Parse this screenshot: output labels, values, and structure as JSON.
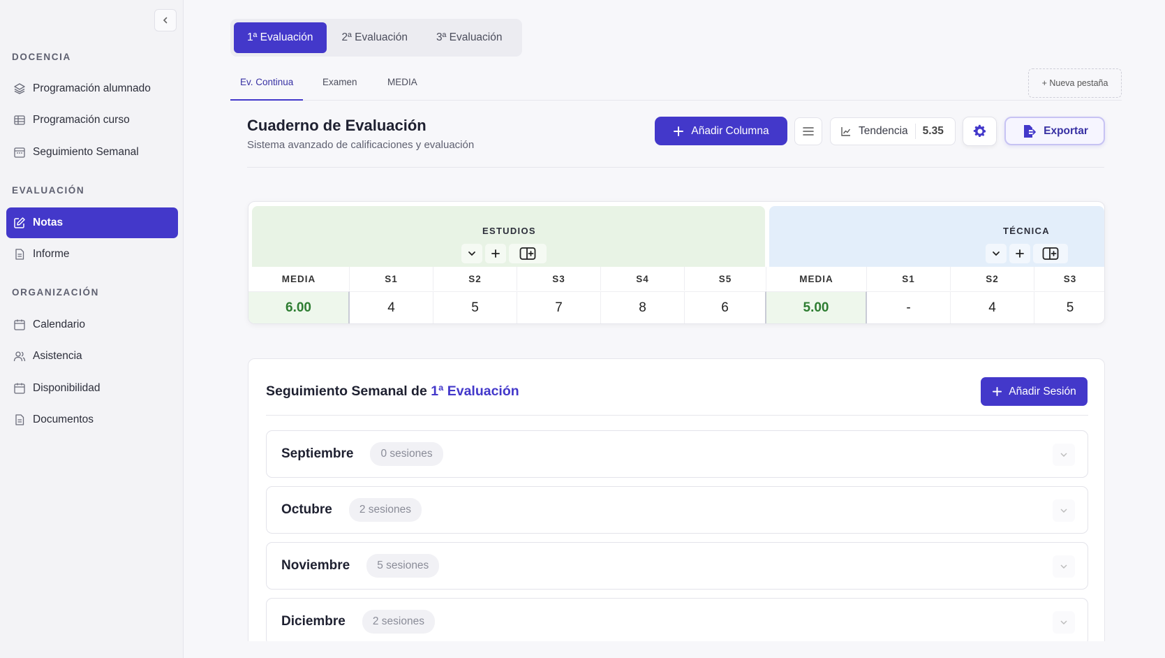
{
  "sidebar": {
    "sections": [
      {
        "title": "DOCENCIA",
        "items": [
          {
            "label": "Programación alumnado",
            "icon": "layers-icon"
          },
          {
            "label": "Programación curso",
            "icon": "table-icon"
          },
          {
            "label": "Seguimiento Semanal",
            "icon": "calendar-week-icon"
          }
        ]
      },
      {
        "title": "EVALUACIÓN",
        "items": [
          {
            "label": "Notas",
            "icon": "edit-icon",
            "active": true
          },
          {
            "label": "Informe",
            "icon": "document-icon"
          }
        ]
      },
      {
        "title": "ORGANIZACIÓN",
        "items": [
          {
            "label": "Calendario",
            "icon": "calendar-icon"
          },
          {
            "label": "Asistencia",
            "icon": "users-icon"
          },
          {
            "label": "Disponibilidad",
            "icon": "calendar-icon"
          },
          {
            "label": "Documentos",
            "icon": "document-icon"
          }
        ]
      }
    ]
  },
  "eval_tabs": [
    "1ª Evaluación",
    "2ª Evaluación",
    "3ª Evaluación"
  ],
  "subtabs": [
    "Ev. Continua",
    "Examen",
    "MEDIA"
  ],
  "new_tab_label": "+ Nueva pestaña",
  "header": {
    "title": "Cuaderno de Evaluación",
    "subtitle": "Sistema avanzado de calificaciones y evaluación",
    "add_column_label": "Añadir Columna",
    "trend_label": "Tendencia",
    "trend_value": "5.35",
    "export_label": "Exportar"
  },
  "grades": {
    "groups": [
      {
        "name": "ESTUDIOS",
        "columns": [
          "MEDIA",
          "S1",
          "S2",
          "S3",
          "S4",
          "S5"
        ],
        "values": [
          "6.00",
          "4",
          "5",
          "7",
          "8",
          "6"
        ]
      },
      {
        "name": "TÉCNICA",
        "columns": [
          "MEDIA",
          "S1",
          "S2",
          "S3"
        ],
        "values": [
          "5.00",
          "-",
          "4",
          "5"
        ]
      }
    ]
  },
  "weekly": {
    "title_prefix": "Seguimiento Semanal de ",
    "title_accent": "1ª Evaluación",
    "add_session_label": "Añadir Sesión",
    "months": [
      {
        "name": "Septiembre",
        "sessions": "0 sesiones"
      },
      {
        "name": "Octubre",
        "sessions": "2 sesiones"
      },
      {
        "name": "Noviembre",
        "sessions": "5 sesiones"
      },
      {
        "name": "Diciembre",
        "sessions": "2 sesiones"
      }
    ]
  },
  "colors": {
    "accent": "#4338ca",
    "media_green": "#2e7d32",
    "estudios_bg": "#e8f3e5",
    "tecnica_bg": "#e3eefa"
  }
}
